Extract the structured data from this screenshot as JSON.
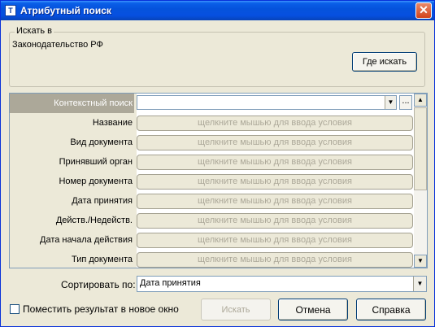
{
  "window": {
    "title": "Атрибутный поиск",
    "icon_name": "app-icon",
    "icon_glyph": "Т",
    "close_glyph": "✕"
  },
  "search_in": {
    "legend": "Искать в",
    "source": "Законодательство РФ",
    "where_button": "Где искать"
  },
  "grid": {
    "context_label": "Контекстный поиск",
    "context_value": "",
    "more_button": "...",
    "placeholder": "щелкните мышью для ввода условия",
    "rows": [
      "Название",
      "Вид документа",
      "Принявший орган",
      "Номер документа",
      "Дата принятия",
      "Действ./Недейств.",
      "Дата начала действия",
      "Тип документа"
    ]
  },
  "sort": {
    "label": "Сортировать по:",
    "value": "Дата принятия"
  },
  "options": {
    "new_window_label": "Поместить результат в новое окно",
    "new_window_checked": false
  },
  "buttons": {
    "search": "Искать",
    "cancel": "Отмена",
    "help": "Справка"
  },
  "colors": {
    "title_bar": "#0553dc",
    "dialog_bg": "#ece9d8",
    "active_label_bg": "#aca899",
    "placeholder_text": "#aca899"
  }
}
